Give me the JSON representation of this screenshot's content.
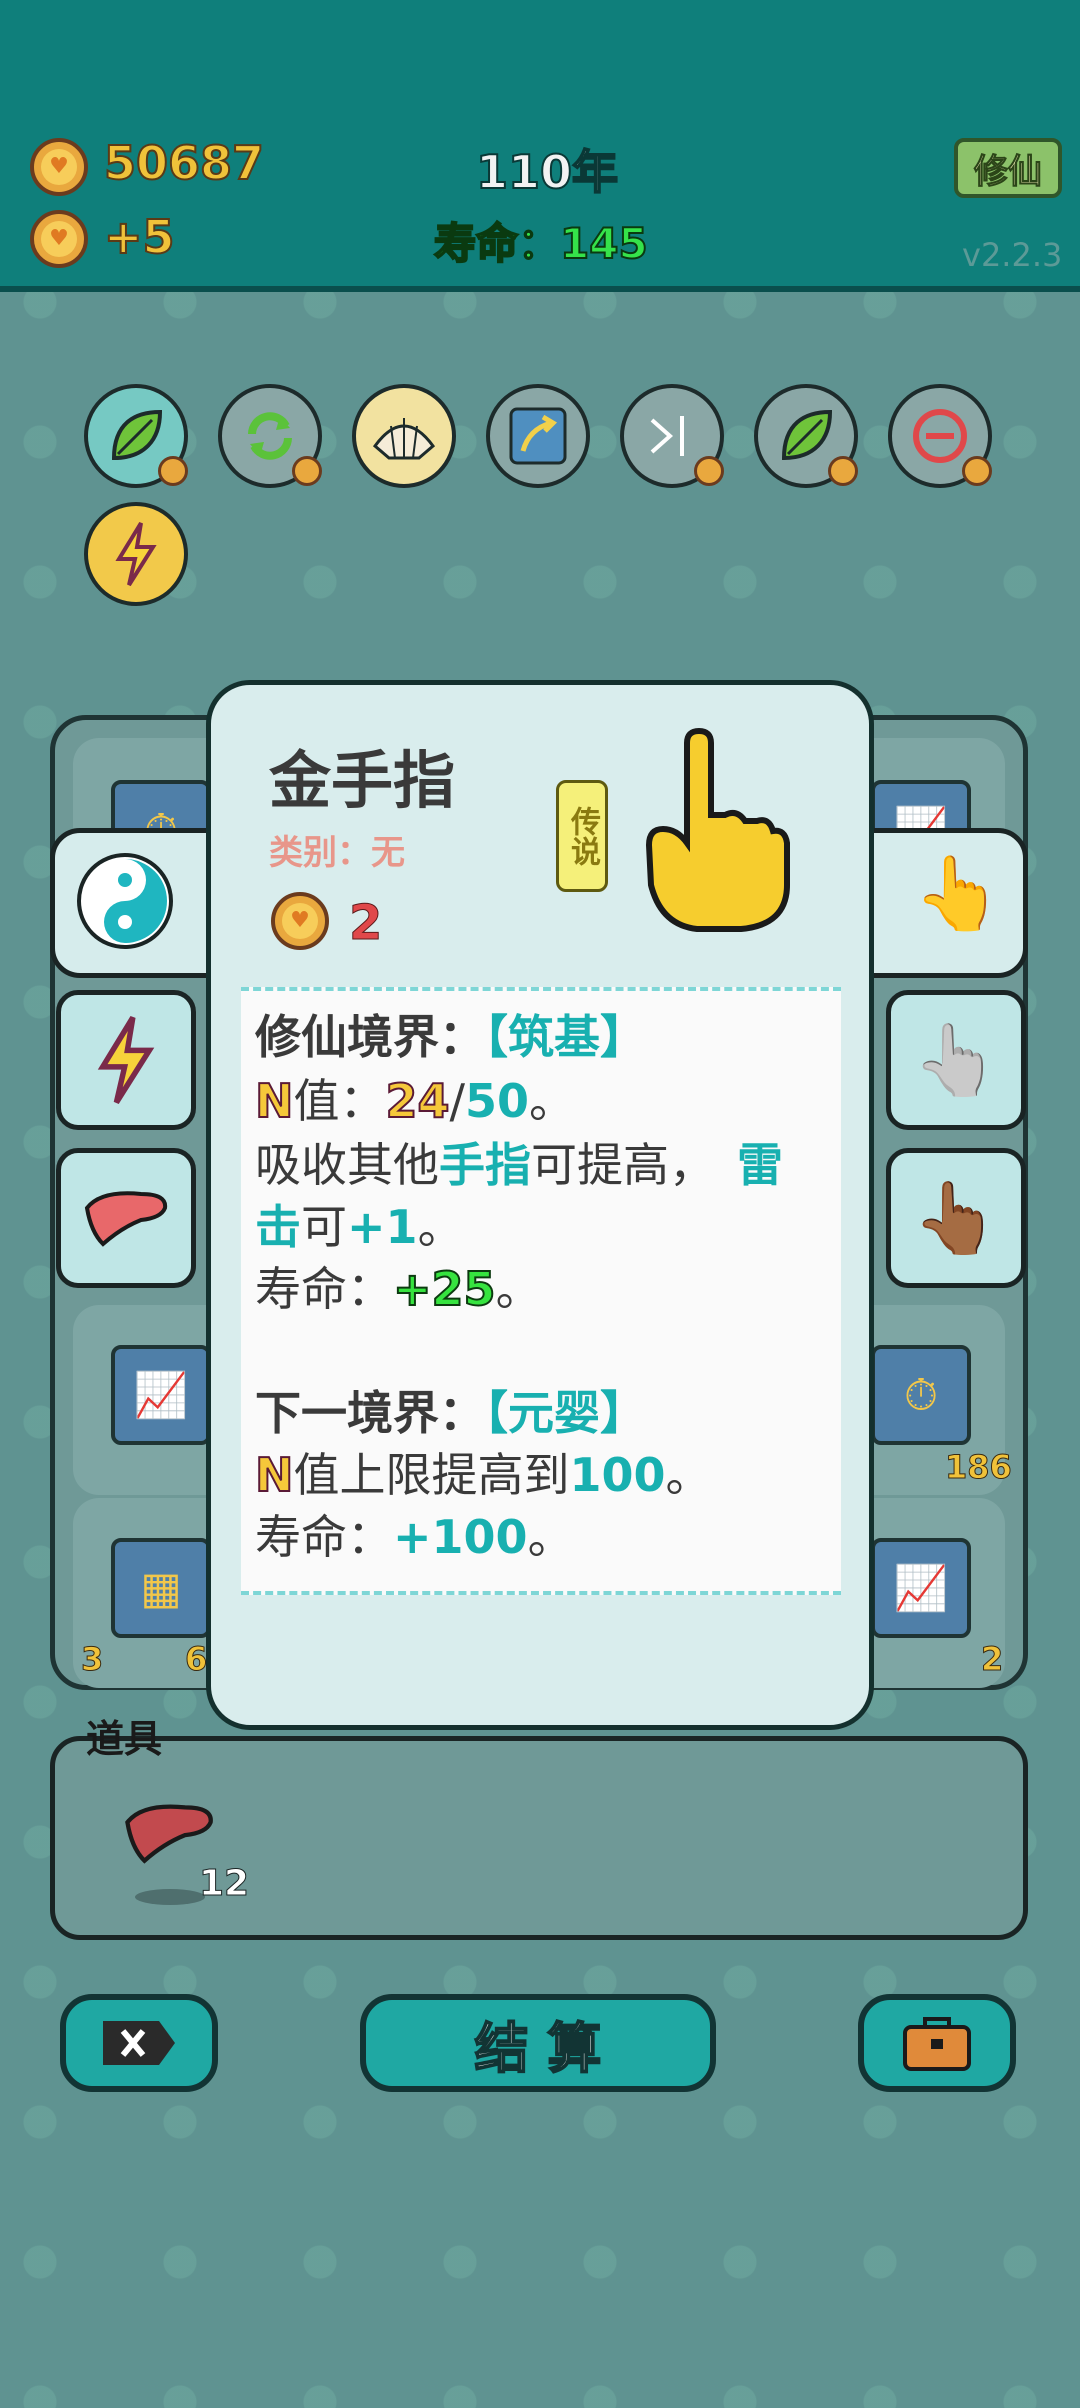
{
  "header": {
    "coins": "50687",
    "income": "+5",
    "year": "110年",
    "lifespan": "寿命：145",
    "cultivate_label": "修仙",
    "version": "v2.2.3"
  },
  "board_numbers": {
    "left_bottom_a": "3",
    "left_bottom_b": "6",
    "right_mid": "186",
    "right_bottom": "2"
  },
  "dialog": {
    "title": "金手指",
    "category": "类别：无",
    "rarity": "传说",
    "cost": "2",
    "realm_label": "修仙境界：",
    "realm_value": "【筑基】",
    "n_label": "N",
    "n_text": "值：",
    "n_current": "24",
    "n_sep": "/",
    "n_max": "50",
    "n_end": "。",
    "absorb_a": "吸收其他",
    "absorb_b": "手指",
    "absorb_c": "可提高，",
    "absorb_d": "雷",
    "absorb_e": "击",
    "absorb_f": "可",
    "absorb_g": "+1",
    "absorb_h": "。",
    "life_label": "寿命：",
    "life_value": "+25",
    "life_end": "。",
    "next_label": "下一境界：",
    "next_value": "【元婴】",
    "next_n_text": "值上限提高到",
    "next_n_value": "100",
    "next_n_end": "。",
    "next_life_label": "寿命：",
    "next_life_value": "+100",
    "next_life_end": "。"
  },
  "items": {
    "label": "道具",
    "liver_count": "12"
  },
  "buttons": {
    "settle": "结 算"
  }
}
